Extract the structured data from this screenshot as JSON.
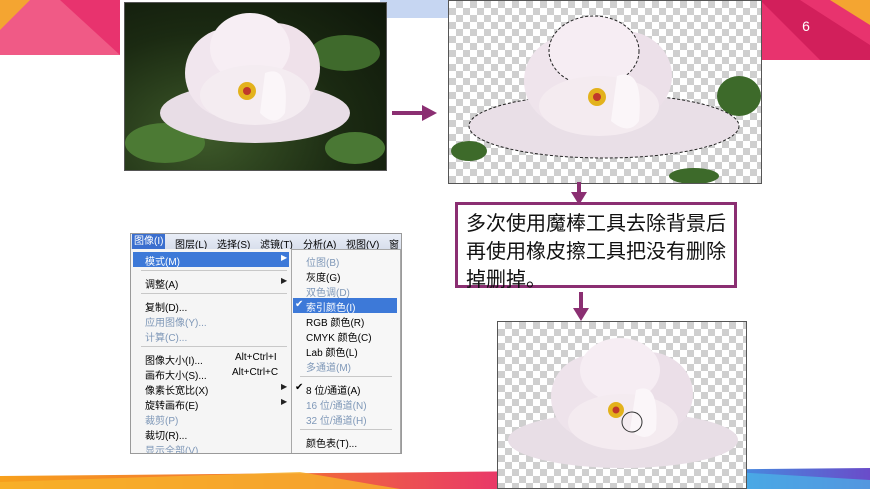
{
  "slide": {
    "number": "6"
  },
  "callout": {
    "text": "多次使用魔棒工具去除背景后再使用橡皮擦工具把没有删除掉删掉。"
  },
  "menubar": {
    "items": [
      "图像(I)",
      "图层(L)",
      "选择(S)",
      "滤镜(T)",
      "分析(A)",
      "视图(V)",
      "窗"
    ]
  },
  "image_menu": {
    "mode": "模式(M)",
    "adjust": "调整(A)",
    "duplicate": "复制(D)...",
    "apply_image": "应用图像(Y)...",
    "calculations": "计算(C)...",
    "image_size": "图像大小(I)...",
    "image_size_shortcut": "Alt+Ctrl+I",
    "canvas_size": "画布大小(S)...",
    "canvas_size_shortcut": "Alt+Ctrl+C",
    "pixel_aspect": "像素长宽比(X)",
    "rotate_canvas": "旋转画布(E)",
    "crop": "裁剪(P)",
    "trim": "裁切(R)...",
    "reveal_all": "显示全部(V)"
  },
  "mode_menu": {
    "bitmap": "位图(B)",
    "grayscale": "灰度(G)",
    "duotone": "双色调(D)",
    "indexed": "索引颜色(I)",
    "rgb": "RGB 颜色(R)",
    "cmyk": "CMYK 颜色(C)",
    "lab": "Lab 颜色(L)",
    "multichannel": "多通道(M)",
    "bit8": "8 位/通道(A)",
    "bit16": "16 位/通道(N)",
    "bit32": "32 位/通道(H)",
    "color_table": "颜色表(T)...",
    "check_mark": "✔"
  },
  "colors": {
    "accent": "#8b2f72",
    "menu_highlight": "#3d79d8",
    "disabled_text": "#7f98b8"
  }
}
